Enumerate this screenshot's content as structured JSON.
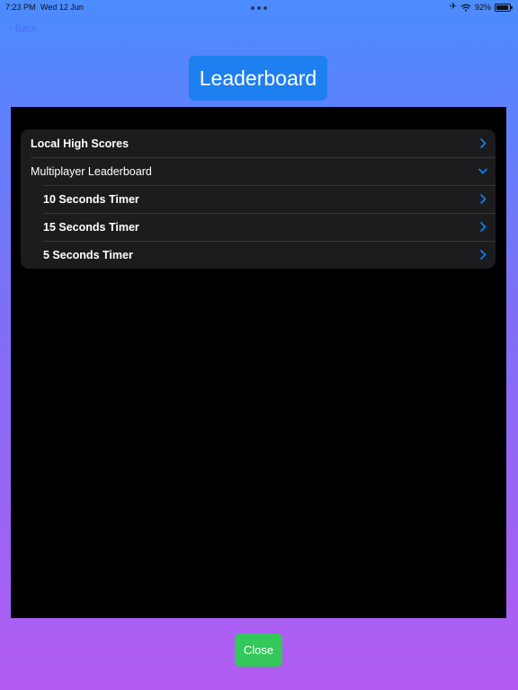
{
  "status_bar": {
    "time": "7:23 PM",
    "date": "Wed 12 Jun",
    "battery": "92%",
    "battery_level": 0.92
  },
  "nav": {
    "back_label": "Back"
  },
  "header": {
    "title": "Leaderboard"
  },
  "list": {
    "items": [
      {
        "label": "Local High Scores",
        "chevron": "chevron-right-icon"
      },
      {
        "label": "Multiplayer Leaderboard",
        "chevron": "chevron-down-icon",
        "expanded": true
      },
      {
        "label": "10 Seconds Timer",
        "chevron": "chevron-right-icon"
      },
      {
        "label": "15 Seconds Timer",
        "chevron": "chevron-right-icon"
      },
      {
        "label": "5 Seconds Timer",
        "chevron": "chevron-right-icon"
      }
    ]
  },
  "footer": {
    "close_label": "Close"
  },
  "colors": {
    "accent": "#0a84ff",
    "title_badge": "#1e7ff0",
    "close_button": "#34c759",
    "panel": "#000000",
    "list_background": "#1c1c1e"
  }
}
